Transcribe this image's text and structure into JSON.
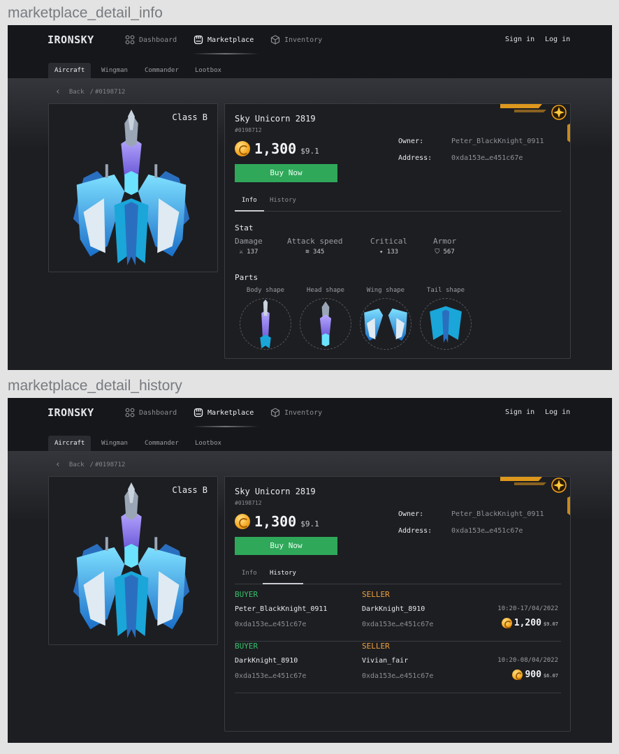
{
  "frames": [
    {
      "title": "marketplace_detail_info"
    },
    {
      "title": "marketplace_detail_history"
    }
  ],
  "app": {
    "logo": "IRONSKY",
    "nav": [
      "Dashboard",
      "Marketplace",
      "Inventory"
    ],
    "active_nav": "Marketplace",
    "sign_in": "Sign in",
    "log_in": "Log in",
    "subtabs": [
      "Aircraft",
      "Wingman",
      "Commander",
      "Lootbox"
    ],
    "active_subtab": "Aircraft",
    "breadcrumb": {
      "back": "Back",
      "sep": "/",
      "id": "#0198712"
    }
  },
  "item": {
    "class": "Class B",
    "name": "Sky Unicorn 2819",
    "id": "#0198712",
    "price": "1,300",
    "price_usd": "$9.1",
    "buy_label": "Buy Now",
    "owner_label": "Owner:",
    "owner": "Peter_BlackKnight_0911",
    "address_label": "Address:",
    "address": "0xda153e…e451c67e"
  },
  "detail_tabs": [
    "Info",
    "History"
  ],
  "info": {
    "stat_title": "Stat",
    "stats": [
      {
        "label": "Damage",
        "value": "137",
        "icon": "sword-icon"
      },
      {
        "label": "Attack speed",
        "value": "345",
        "icon": "speed-icon"
      },
      {
        "label": "Critical",
        "value": "133",
        "icon": "critical-icon"
      },
      {
        "label": "Armor",
        "value": "567",
        "icon": "shield-icon"
      }
    ],
    "parts_title": "Parts",
    "parts": [
      "Body shape",
      "Head shape",
      "Wing shape",
      "Tail shape"
    ]
  },
  "history": {
    "buyer_label": "BUYER",
    "seller_label": "SELLER",
    "rows": [
      {
        "buyer": "Peter_BlackKnight_0911",
        "buyer_addr": "0xda153e…e451c67e",
        "seller": "DarkKnight_8910",
        "seller_addr": "0xda153e…e451c67e",
        "date": "10:20-17/04/2022",
        "price": "1,200",
        "usd": "$9.07"
      },
      {
        "buyer": "DarkKnight_8910",
        "buyer_addr": "0xda153e…e451c67e",
        "seller": "Vivian_fair",
        "seller_addr": "0xda153e…e451c67e",
        "date": "10:20-08/04/2022",
        "price": "900",
        "usd": "$6.07"
      }
    ]
  },
  "colors": {
    "buy": "#2fa85a",
    "buyer": "#37c06a",
    "seller": "#f0a03c",
    "accent": "#f3a51d"
  }
}
